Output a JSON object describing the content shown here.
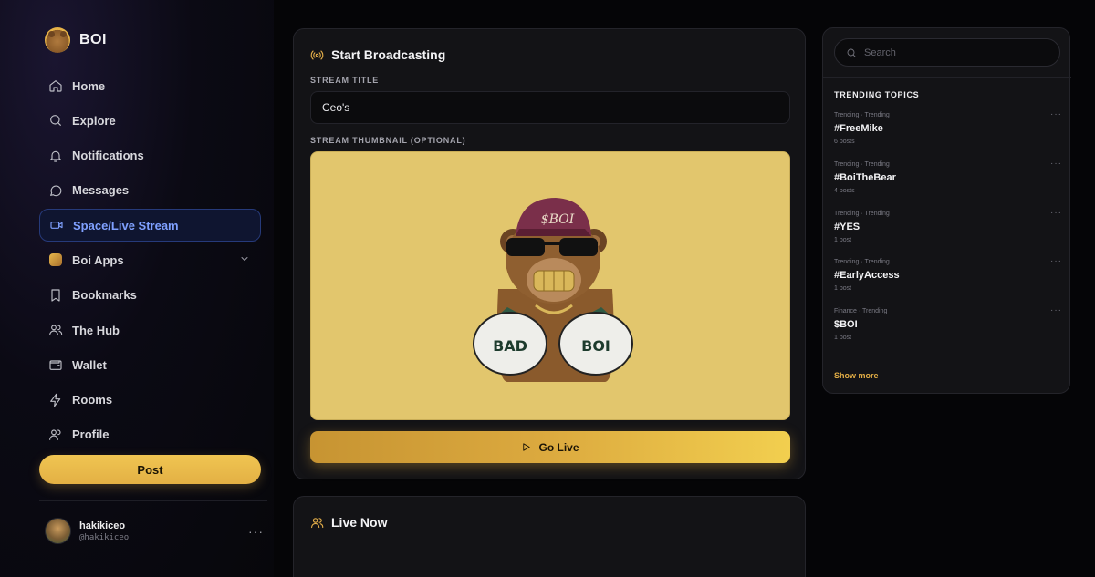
{
  "brand": {
    "name": "BOI"
  },
  "nav": {
    "items": [
      {
        "label": "Home",
        "icon": "home-icon"
      },
      {
        "label": "Explore",
        "icon": "search-icon"
      },
      {
        "label": "Notifications",
        "icon": "bell-icon"
      },
      {
        "label": "Messages",
        "icon": "message-icon"
      },
      {
        "label": "Space/Live Stream",
        "icon": "video-icon",
        "active": true
      },
      {
        "label": "Boi Apps",
        "icon": "apps-icon"
      },
      {
        "label": "Bookmarks",
        "icon": "bookmark-icon"
      },
      {
        "label": "The Hub",
        "icon": "users-icon"
      },
      {
        "label": "Wallet",
        "icon": "wallet-icon"
      },
      {
        "label": "Rooms",
        "icon": "lightning-icon"
      },
      {
        "label": "Profile",
        "icon": "profile-icon"
      }
    ],
    "post_label": "Post"
  },
  "user": {
    "name": "hakikiceo",
    "handle": "@hakikiceo",
    "more": "···"
  },
  "broadcast": {
    "title": "Start Broadcasting",
    "stream_title_label": "STREAM TITLE",
    "stream_title_value": "Ceo's",
    "thumbnail_label": "STREAM THUMBNAIL (OPTIONAL)",
    "thumbnail_text": {
      "cap": "$BOI",
      "left_glove": "BAD",
      "right_glove": "BOI"
    },
    "go_live_label": "Go Live"
  },
  "live_now": {
    "title": "Live Now"
  },
  "rail": {
    "search_placeholder": "Search",
    "heading": "TRENDING TOPICS",
    "trends": [
      {
        "meta": "Trending · Trending",
        "tag": "#FreeMike",
        "count": "6 posts"
      },
      {
        "meta": "Trending · Trending",
        "tag": "#BoiTheBear",
        "count": "4 posts"
      },
      {
        "meta": "Trending · Trending",
        "tag": "#YES",
        "count": "1 post"
      },
      {
        "meta": "Trending · Trending",
        "tag": "#EarlyAccess",
        "count": "1 post"
      },
      {
        "meta": "Finance · Trending",
        "tag": "$BOI",
        "count": "1 post"
      }
    ],
    "trend_more": "···",
    "show_more": "Show more"
  },
  "colors": {
    "accent": "#e6b04a",
    "active_nav": "#7fa0ff",
    "thumbnail_bg": "#e2c66d"
  }
}
